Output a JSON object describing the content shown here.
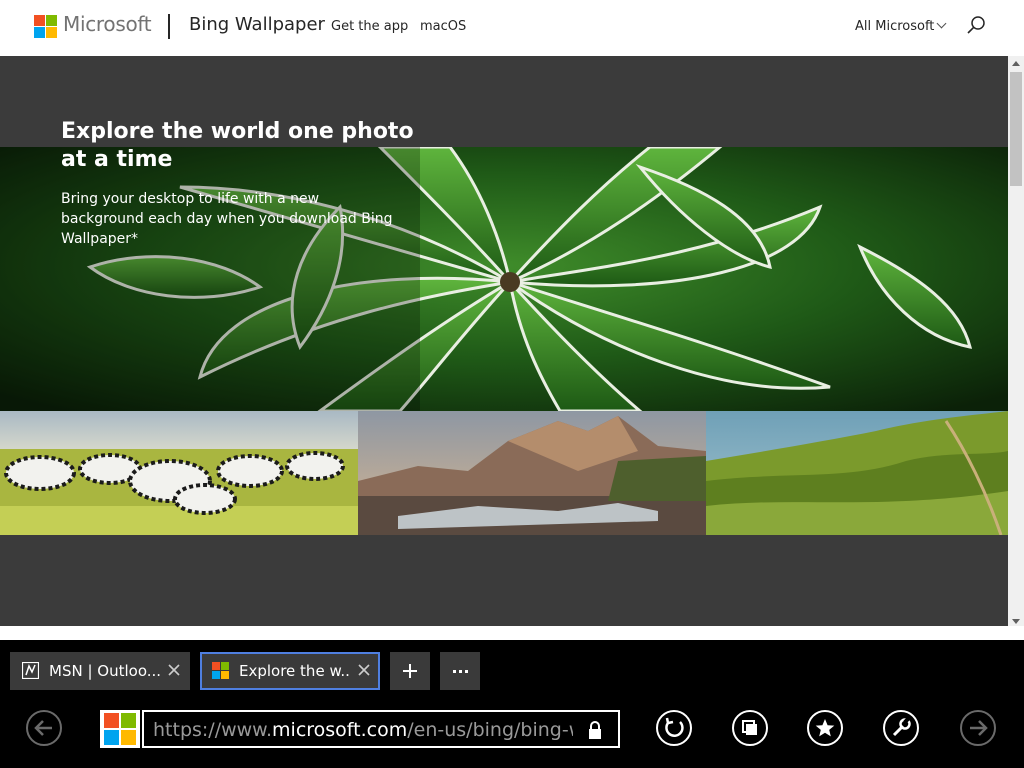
{
  "topnav": {
    "brand": "Microsoft",
    "product": "Bing Wallpaper",
    "links": [
      "Get the app",
      "macOS"
    ],
    "all_microsoft": "All Microsoft",
    "logo_colors": [
      "#f25022",
      "#7fba00",
      "#00a4ef",
      "#ffb900"
    ]
  },
  "hero": {
    "title": "Explore the world one photo at a time",
    "subtitle": "Bring your desktop to life with a new background each day when you download Bing Wallpaper*"
  },
  "browser": {
    "tabs": [
      {
        "label": "MSN | Outloo...",
        "active": false,
        "icon": "msn-icon"
      },
      {
        "label": "Explore the w...",
        "active": true,
        "icon": "microsoft-logo-icon"
      }
    ],
    "address": {
      "prefix": "https://www.",
      "domain": "microsoft.com",
      "path": "/en-us/bing/bing-w"
    },
    "accent": "#4f7fe0"
  }
}
